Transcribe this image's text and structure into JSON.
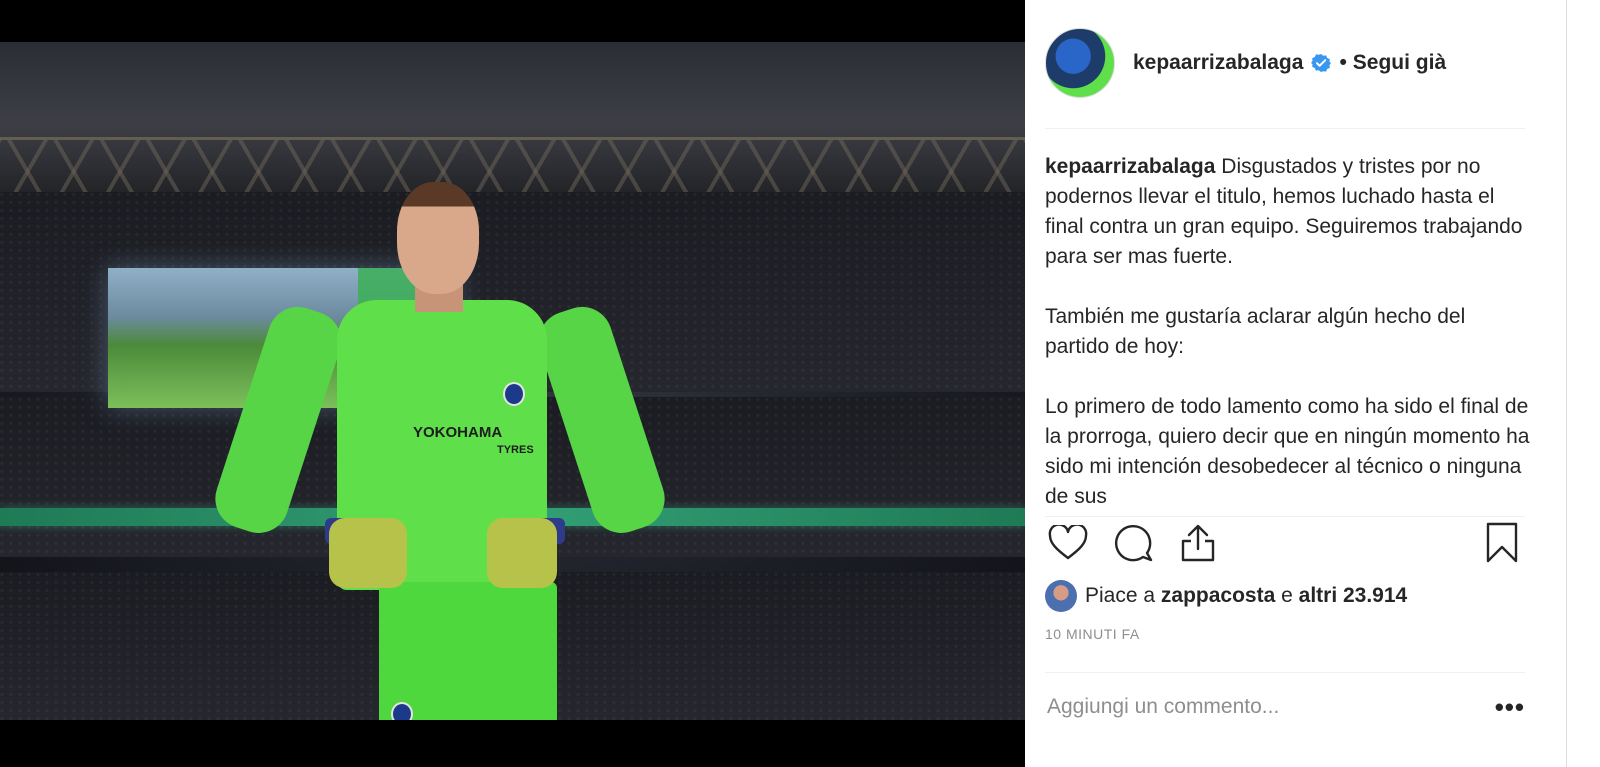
{
  "post": {
    "username": "kepaarrizabalaga",
    "follow_status": "Segui già",
    "separator": "•",
    "caption_paragraphs": [
      "Disgustados y tristes por no podernos llevar el titulo, hemos luchado hasta el final contra un gran equipo. Seguiremos trabajando para ser mas fuerte.",
      "También me gustaría aclarar algún hecho del partido de hoy:",
      "Lo primero de todo lamento como ha sido el final de la prorroga, quiero decir que en ningún momento ha sido mi intención desobedecer al técnico o ninguna de sus"
    ],
    "likes_prefix": "Piace a",
    "likes_user": "zappacosta",
    "likes_mid": "e",
    "likes_count": "altri 23.914",
    "timestamp": "10 MINUTI FA",
    "comment_placeholder": "Aggiungi un commento...",
    "more_label": "•••"
  },
  "photo": {
    "sponsor": "YOKOHAMA",
    "sponsor_sub": "TYRES"
  },
  "icons": {
    "like": "heart-icon",
    "comment": "comment-icon",
    "share": "share-icon",
    "save": "bookmark-icon",
    "verified": "verified-badge-icon"
  },
  "colors": {
    "text": "#262626",
    "muted": "#8e8e8e",
    "verified": "#3897f0",
    "kit": "#5fe04a"
  }
}
